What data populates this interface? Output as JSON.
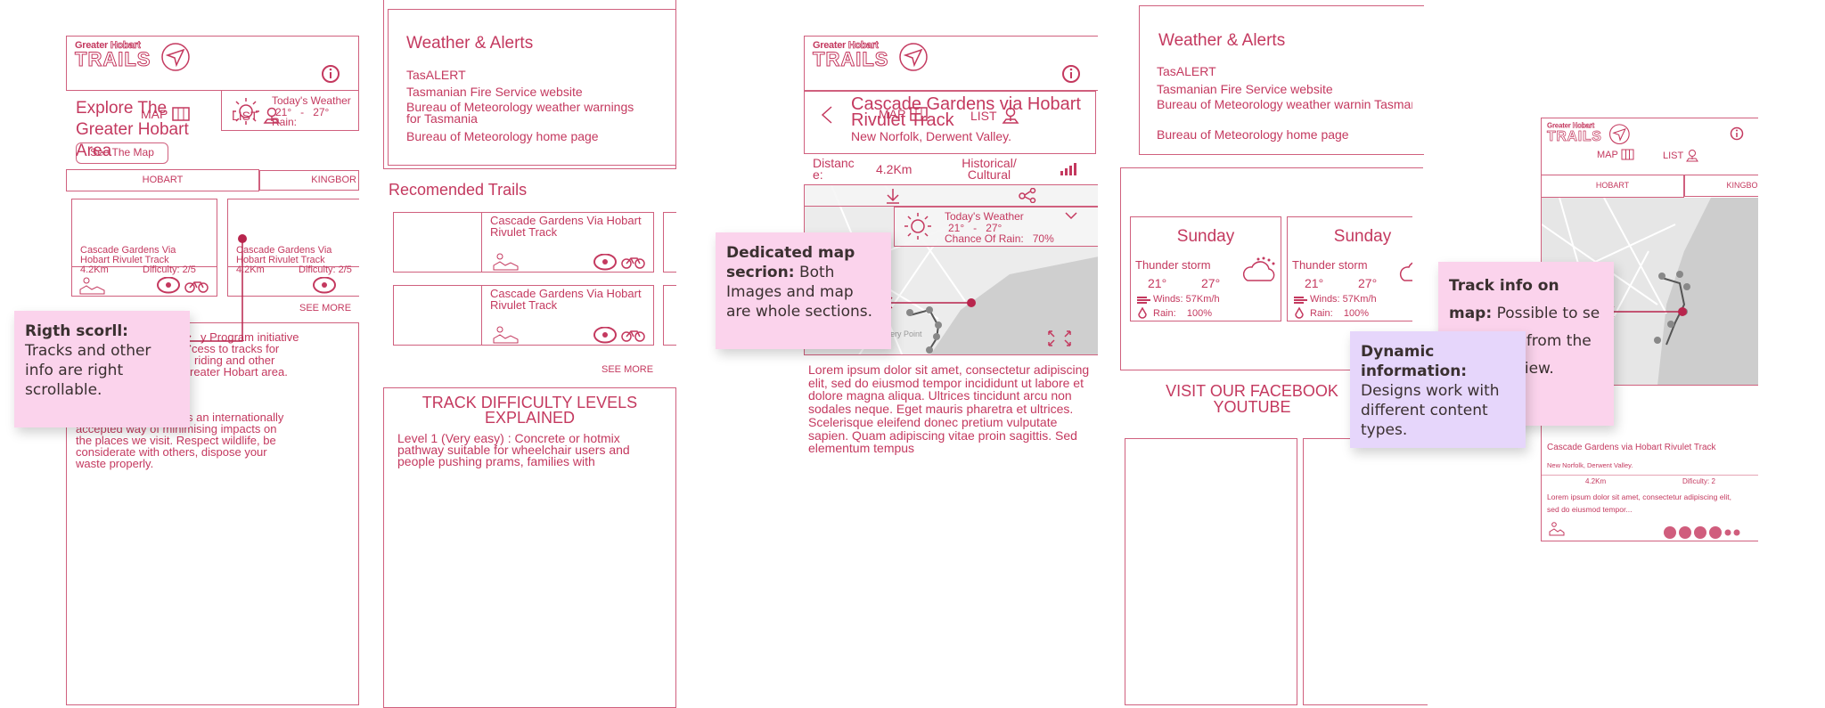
{
  "colors": {
    "primary": "#c4395f",
    "sticky_pink": "#fbd3ec",
    "sticky_purple": "#e6d6fb",
    "map_gray": "#d9d9d9"
  },
  "logo": {
    "line1_a": "Greater",
    "line1_b": "Hobart",
    "line2": "TRAILS"
  },
  "nav": {
    "map": "MAP",
    "list": "LIST"
  },
  "screen1": {
    "heading": "Explore The Greater Hobart Area",
    "weather": {
      "title": "Today's Weather",
      "low": "21°",
      "sep": "-",
      "high": "27°",
      "rain_label": "Rain:"
    },
    "see_map": "See The Map",
    "tabs": [
      "HOBART",
      "KINGBOR"
    ],
    "cards": [
      {
        "title": "Cascade Gardens Via Hobart Rivulet Track",
        "distance": "4.2Km",
        "difficulty": "Dificulty: 2/5"
      },
      {
        "title": "Cascade Gardens Via Hobart Rivulet Track",
        "distance": "4.2Km",
        "difficulty": "Dificulty: 2/5"
      }
    ],
    "see_more": "SEE MORE",
    "text_fragments": [
      "y Program initiative",
      "cess to tracks for",
      "riding and other",
      "reater Hobart area.",
      "s an internationally",
      "accepted way of minimising impacts on",
      "the places we visit. Respect wildlife, be",
      "considerate with others, dispose your",
      "waste properly."
    ]
  },
  "screen2": {
    "alerts_title": "Weather & Alerts",
    "alerts": [
      "TasALERT",
      "Tasmanian Fire Service website",
      "Bureau of Meteorology weather warnings for Tasmania",
      "Bureau of Meteorology home page"
    ],
    "recommended_title": "Recomended Trails",
    "cards": [
      {
        "title": "Cascade Gardens Via Hobart Rivulet Track"
      },
      {
        "title": "Cascade Gardens Via Hobart Rivulet Track"
      }
    ],
    "see_more": "SEE MORE",
    "difficulty_title": "TRACK DIFFICULTY LEVELS EXPLAINED",
    "difficulty_text": "Level 1 (Very easy) : Concrete or hotmix pathway suitable for wheelchair users and people pushing prams, families with"
  },
  "screen3": {
    "title": "Cascade Gardens via Hobart Rivulet Track",
    "subtitle": "New Norfolk, Derwent Valley.",
    "distance_label": "Distance:",
    "distance": "4.2Km",
    "category": "Historical/ Cultural",
    "weather": {
      "title": "Today's Weather",
      "low": "21°",
      "sep": "-",
      "high": "27°",
      "rain_label": "Chance Of Rain:",
      "rain": "70%"
    },
    "map_labels": [
      "Battery Point"
    ],
    "body": "Lorem ipsum dolor sit amet, consectetur adipiscing elit, sed do eiusmod tempor incididunt ut labore et dolore magna aliqua. Ultrices tincidunt arcu non sodales neque. Eget mauris pharetra et ultrices. Scelerisque eleifend donec pretium vulputate sapien. Quam adipiscing vitae proin sagittis. Sed elementum tempus"
  },
  "screen4": {
    "alerts_title": "Weather & Alerts",
    "alerts": [
      "TasALERT",
      "Tasmanian Fire Service website",
      "Bureau of Meteorology weather warnin Tasmania",
      "Bureau of Meteorology home page"
    ],
    "forecast": [
      {
        "day": "Sunday",
        "condition": "Thunder storm",
        "low": "21°",
        "high": "27°",
        "winds": "Winds: 57Km/h",
        "rain_label": "Rain:",
        "rain": "100%"
      },
      {
        "day": "Sunday",
        "condition": "Thunder storm",
        "low": "21°",
        "high": "27°",
        "winds": "Winds: 57Km/h",
        "rain_label": "Rain:",
        "rain": "100%"
      }
    ],
    "social": "VISIT OUR FACEBOOK YOUTUBE"
  },
  "screen5": {
    "tabs": [
      "HOBART",
      "KINGBOR"
    ],
    "title": "Cascade Gardens via Hobart Rivulet Track",
    "subtitle": "New Norfolk, Derwent Valley.",
    "distance": "4.2Km",
    "difficulty": "Dificulty: 2",
    "body": "Lorem ipsum dolor sit amet, consectetur adipiscing elit, sed do eiusmod tempor..."
  },
  "notes": [
    {
      "bold": "Rigth scorll:",
      "text": "Tracks and other info are right scrollable."
    },
    {
      "bold": "Dedicated map secrion:",
      "text": "Both Images and map are whole sections."
    },
    {
      "bold": "Track info on map:",
      "text": "Possible to se basic info from the full map view."
    },
    {
      "bold": "Dynamic information:",
      "text": "Designs work with different content types."
    }
  ]
}
